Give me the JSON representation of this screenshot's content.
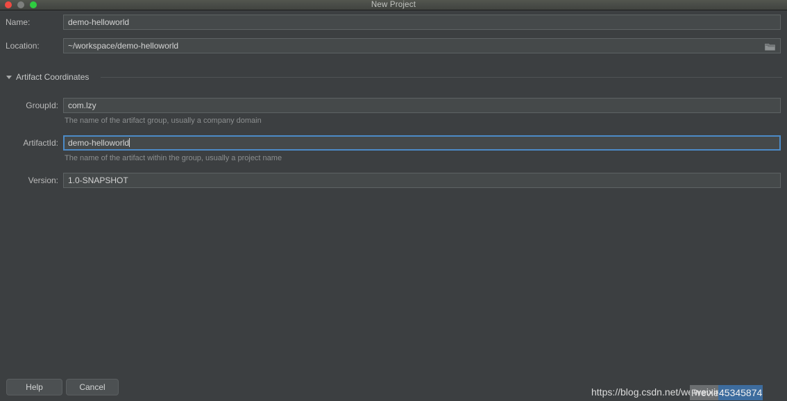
{
  "window": {
    "title": "New Project",
    "traffic_lights": [
      {
        "name": "close",
        "color": "#ef4b42"
      },
      {
        "name": "minimize",
        "color": "#7d7f7d"
      },
      {
        "name": "zoom",
        "color": "#2ecc40"
      }
    ]
  },
  "theme": {
    "background": "#3c3f41",
    "titlebar": "#494c4a",
    "field_bg": "#45494a",
    "field_border": "#5e6364",
    "focus_border": "#4c8bc8",
    "label_text": "#bbbbbb",
    "hint_text": "#8c8f90",
    "selection_blue": "#3d6c9e"
  },
  "form": {
    "name": {
      "label": "Name:",
      "value": "demo-helloworld",
      "placeholder": "Name"
    },
    "location": {
      "label": "Location:",
      "value": "~/workspace/demo-helloworld",
      "placeholder": "Location",
      "browse_icon": "folder-icon"
    }
  },
  "artifact_section": {
    "title": "Artifact Coordinates",
    "expanded": true,
    "toggle_icon": "chevron-down-icon",
    "fields": {
      "group_id": {
        "label": "GroupId:",
        "value": "com.lzy",
        "hint": "The name of the artifact group, usually a company domain",
        "focused": false
      },
      "artifact_id": {
        "label": "ArtifactId:",
        "value": "demo-helloworld",
        "hint": "The name of the artifact within the group, usually a project name",
        "focused": true
      },
      "version": {
        "label": "Version:",
        "value": "1.0-SNAPSHOT",
        "hint": "",
        "focused": false
      }
    }
  },
  "footer": {
    "help_label": "Help",
    "cancel_label": "Cancel"
  },
  "watermark": {
    "base_text": "https://blog.csdn.net/weixin_45345874",
    "overlay_text": "Preview",
    "selected_text": "45345874",
    "overlap_text": "weixin_"
  }
}
